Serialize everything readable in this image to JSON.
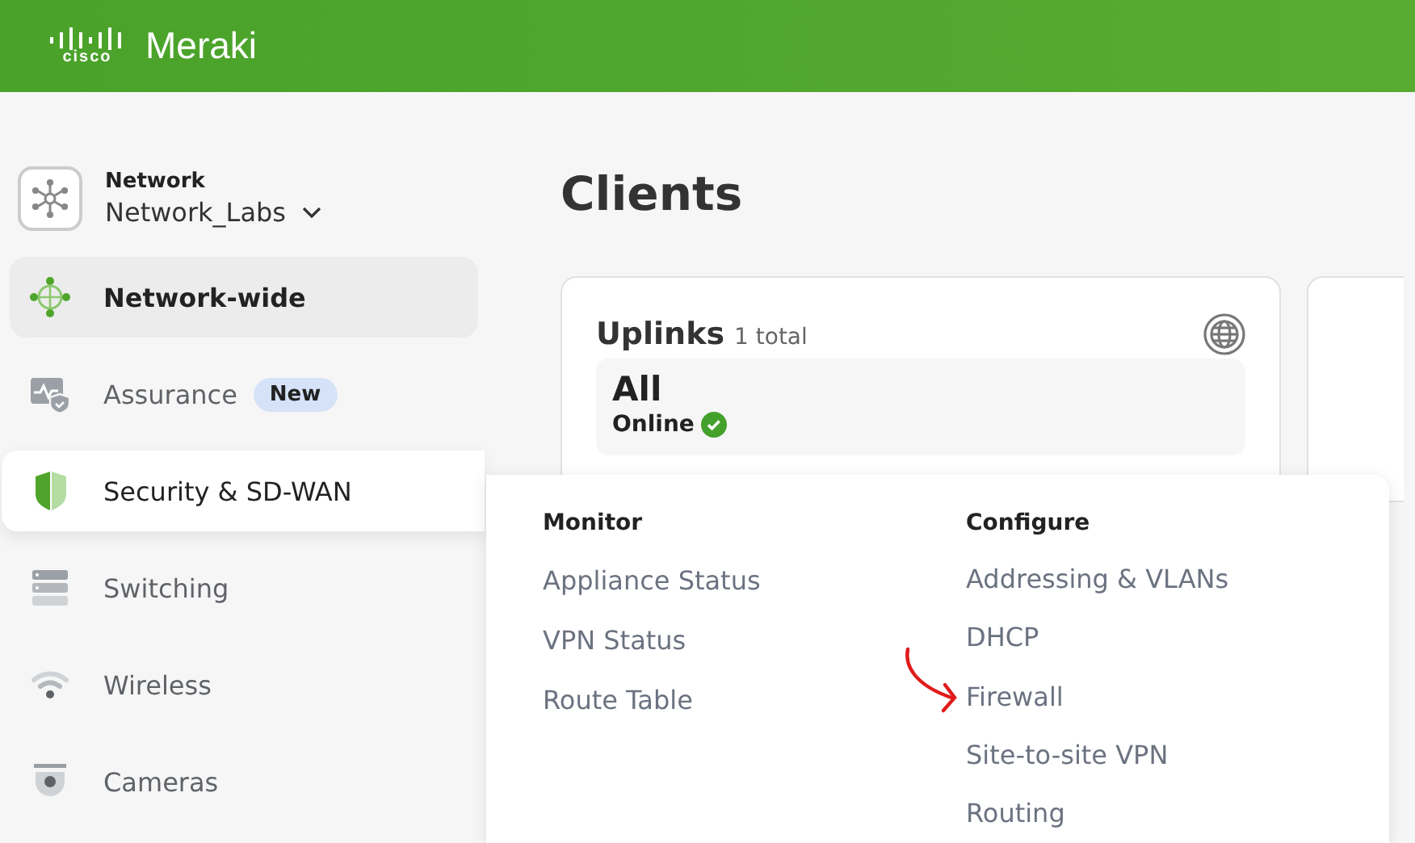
{
  "header": {
    "logo_mark": "cisco",
    "product": "Meraki"
  },
  "network": {
    "label": "Network",
    "name": "Network_Labs"
  },
  "sidebar": {
    "items": [
      {
        "label": "Network-wide",
        "kind": "globe",
        "selected": true,
        "expanded": false
      },
      {
        "label": "Assurance",
        "kind": "pulse",
        "selected": false,
        "expanded": false,
        "badge": "New"
      },
      {
        "label": "Security & SD-WAN",
        "kind": "shield",
        "selected": false,
        "expanded": true
      },
      {
        "label": "Switching",
        "kind": "switch",
        "selected": false,
        "expanded": false
      },
      {
        "label": "Wireless",
        "kind": "wifi",
        "selected": false,
        "expanded": false
      },
      {
        "label": "Cameras",
        "kind": "camera",
        "selected": false,
        "expanded": false
      }
    ]
  },
  "page": {
    "title": "Clients"
  },
  "uplinks_card": {
    "title": "Uplinks",
    "count": "1 total",
    "filter": "All",
    "status": "Online"
  },
  "flyout": {
    "columns": [
      {
        "heading": "Monitor",
        "items": [
          "Appliance Status",
          "VPN Status",
          "Route Table"
        ]
      },
      {
        "heading": "Configure",
        "items": [
          "Addressing & VLANs",
          "DHCP",
          "Firewall",
          "Site-to-site VPN",
          "Routing"
        ]
      }
    ]
  }
}
